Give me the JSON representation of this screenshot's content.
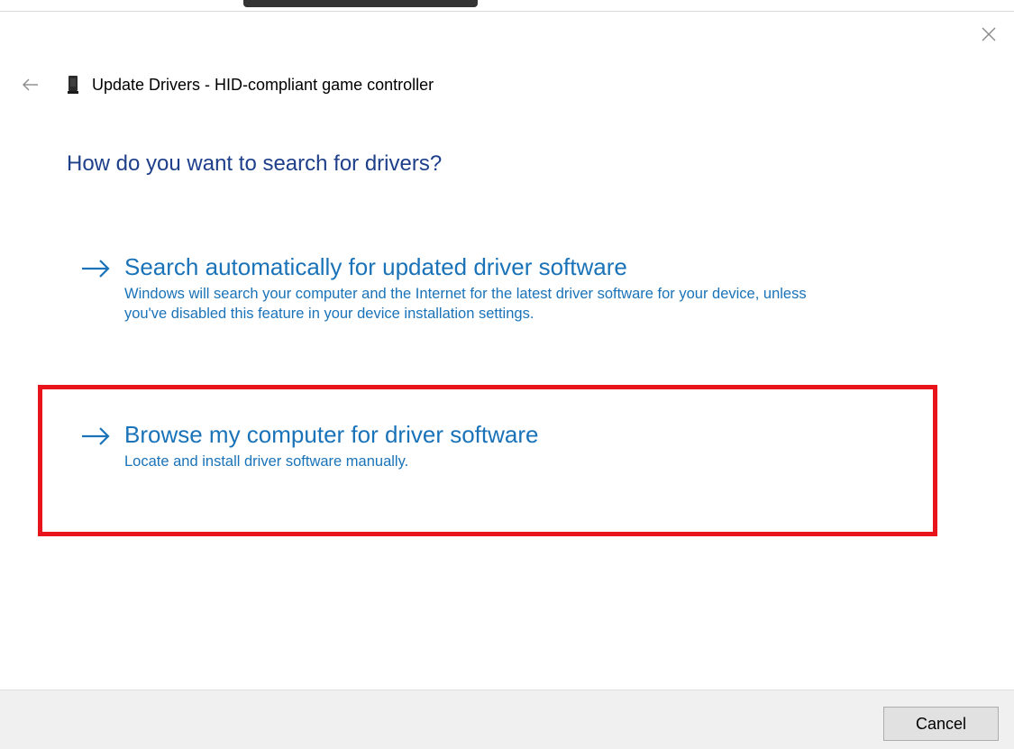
{
  "window": {
    "title": "Update Drivers - HID-compliant game controller"
  },
  "question": "How do you want to search for drivers?",
  "options": [
    {
      "title": "Search automatically for updated driver software",
      "description": "Windows will search your computer and the Internet for the latest driver software for your device, unless you've disabled this feature in your device installation settings."
    },
    {
      "title": "Browse my computer for driver software",
      "description": "Locate and install driver software manually."
    }
  ],
  "footer": {
    "cancel_label": "Cancel"
  },
  "colors": {
    "link": "#1a73b8",
    "question": "#1e3f8a",
    "highlight": "#e8141b",
    "footer_bg": "#f0f0f0"
  },
  "icons": [
    "close-icon",
    "back-arrow-icon",
    "game-controller-device-icon",
    "right-arrow-icon"
  ]
}
